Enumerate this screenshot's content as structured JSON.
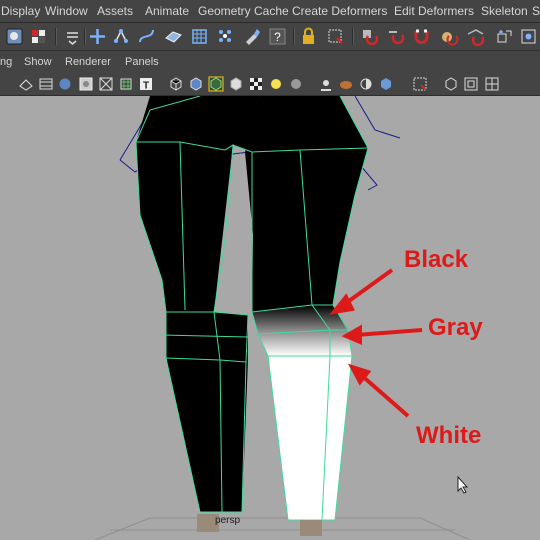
{
  "menubar": {
    "items": [
      "Display",
      "Window",
      "Assets",
      "Animate",
      "Geometry Cache",
      "Create Deformers",
      "Edit Deformers",
      "Skeleton",
      "S"
    ]
  },
  "panel": {
    "menu": [
      "ng",
      "Show",
      "Renderer",
      "Panels"
    ]
  },
  "viewport": {
    "camera_label": "persp",
    "annotations": {
      "black": "Black",
      "gray": "Gray",
      "white": "White"
    },
    "colors": {
      "background": "#a8a8a8",
      "mesh_black": "#000000",
      "wireframe": "#3ddc9a",
      "skeleton": "#1a1a8c",
      "annotation": "#dd1a1a"
    }
  },
  "icons": {
    "toolbar": [
      "select-tool-icon",
      "lasso-icon",
      "menu-arrow-icon",
      "move-icon",
      "rotate-icon",
      "curve-icon",
      "surface-icon",
      "grid-snap-icon",
      "point-snap-icon",
      "paint-icon",
      "help-icon",
      "lock-icon",
      "render-icon",
      "snap-curve-icon",
      "snap-point-icon",
      "magnet-icon",
      "sphere-icon",
      "snap-plane-icon",
      "camera-icon",
      "constraint-icon"
    ],
    "panel_toolbar": [
      "camera-icon",
      "film-icon",
      "grid-icon",
      "sphere-icon",
      "wire-icon",
      "xray-icon",
      "texture-icon",
      "cube-icon",
      "smooth-icon",
      "select-icon",
      "wireframe-cube-icon",
      "checker-icon",
      "light-icon",
      "shadow-icon",
      "shaded-icon",
      "isolate-icon",
      "frame-icon",
      "layout-icon"
    ]
  }
}
